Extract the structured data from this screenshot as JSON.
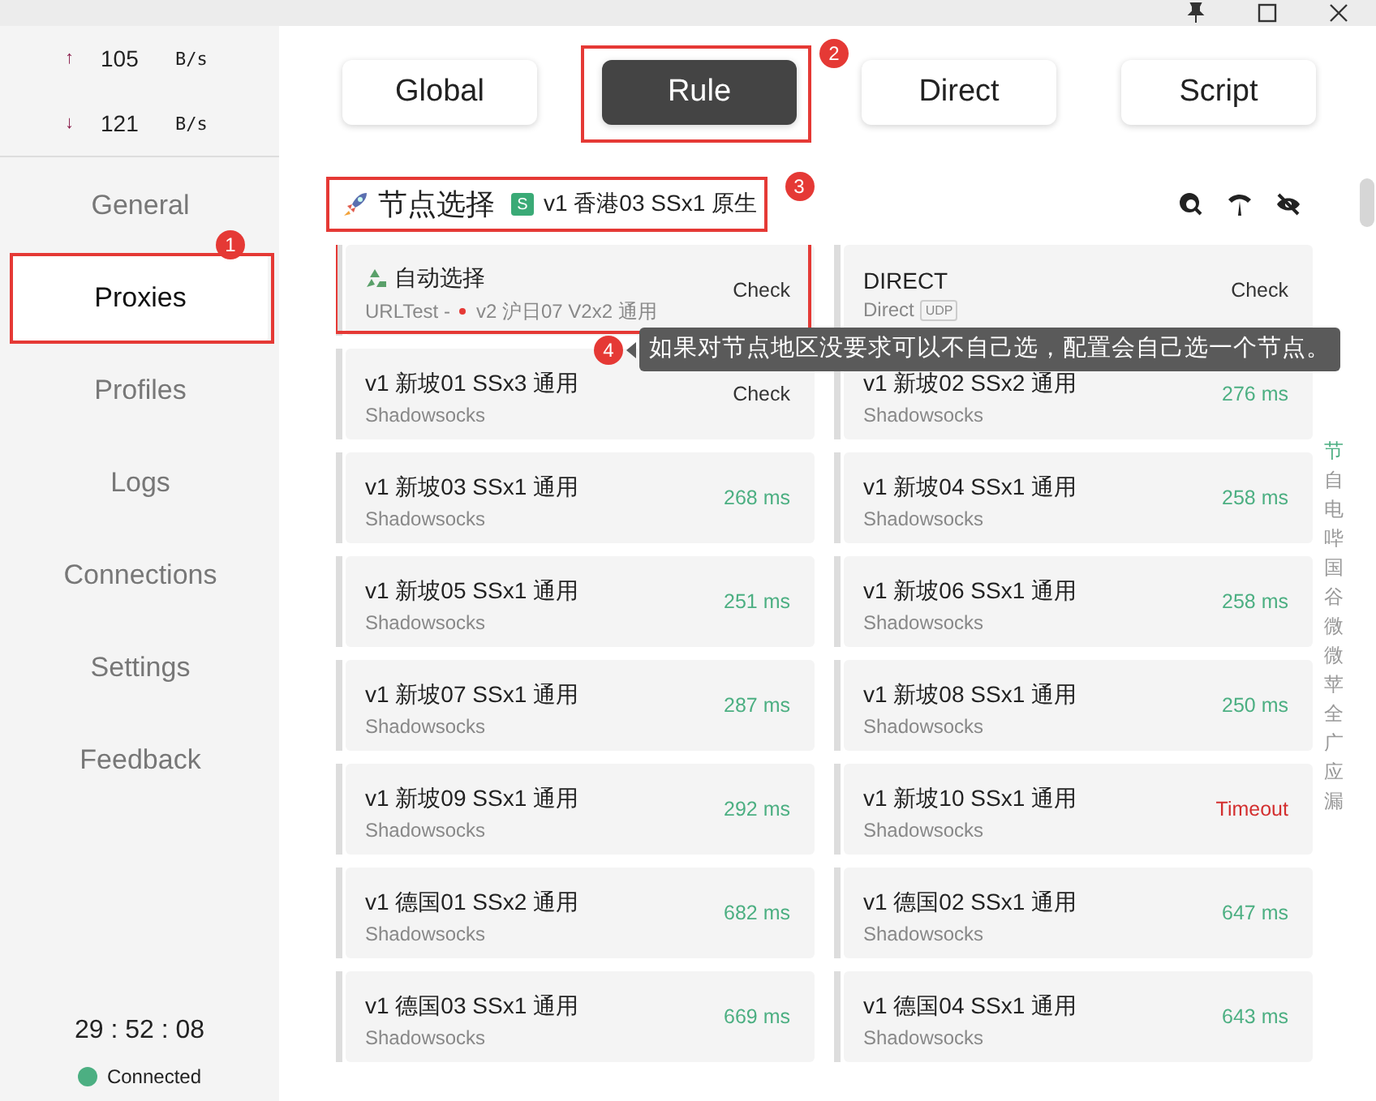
{
  "traffic": [
    {
      "arrow": "↑",
      "value": "105",
      "unit": "B/s"
    },
    {
      "arrow": "↓",
      "value": "121",
      "unit": "B/s"
    }
  ],
  "nav": [
    {
      "label": "General",
      "selected": false
    },
    {
      "label": "Proxies",
      "selected": true,
      "step": "1"
    },
    {
      "label": "Profiles",
      "selected": false
    },
    {
      "label": "Logs",
      "selected": false
    },
    {
      "label": "Connections",
      "selected": false
    },
    {
      "label": "Settings",
      "selected": false
    },
    {
      "label": "Feedback",
      "selected": false
    }
  ],
  "uptime": "29 : 52 : 08",
  "status": {
    "label": "Connected",
    "online": true
  },
  "modes": [
    {
      "label": "Global",
      "selected": false
    },
    {
      "label": "Rule",
      "selected": true,
      "step": "2"
    },
    {
      "label": "Direct",
      "selected": false
    },
    {
      "label": "Script",
      "selected": false
    }
  ],
  "group": {
    "name": "节点选择",
    "badge": "S",
    "current": "v1 香港03 SSx1 原生",
    "step": "3"
  },
  "proxies": [
    {
      "kind": "group",
      "name": "自动选择",
      "type": "URLTest -",
      "now": "v2 沪日07 V2x2 通用",
      "delay": "Check",
      "color": "#333333"
    },
    {
      "kind": "direct",
      "name": "DIRECT",
      "type": "Direct",
      "tag": "UDP",
      "delay": "Check",
      "color": "#333333"
    },
    {
      "kind": "proxy",
      "name": "v1 新坡01 SSx3 通用",
      "type": "Shadowsocks",
      "delay": "Check",
      "color": "#333333"
    },
    {
      "kind": "proxy",
      "name": "v1 新坡02 SSx2 通用",
      "type": "Shadowsocks",
      "delay": "276 ms",
      "color": "#4caf82"
    },
    {
      "kind": "proxy",
      "name": "v1 新坡03 SSx1 通用",
      "type": "Shadowsocks",
      "delay": "268 ms",
      "color": "#4caf82"
    },
    {
      "kind": "proxy",
      "name": "v1 新坡04 SSx1 通用",
      "type": "Shadowsocks",
      "delay": "258 ms",
      "color": "#4caf82"
    },
    {
      "kind": "proxy",
      "name": "v1 新坡05 SSx1 通用",
      "type": "Shadowsocks",
      "delay": "251 ms",
      "color": "#4caf82"
    },
    {
      "kind": "proxy",
      "name": "v1 新坡06 SSx1 通用",
      "type": "Shadowsocks",
      "delay": "258 ms",
      "color": "#4caf82"
    },
    {
      "kind": "proxy",
      "name": "v1 新坡07 SSx1 通用",
      "type": "Shadowsocks",
      "delay": "287 ms",
      "color": "#4caf82"
    },
    {
      "kind": "proxy",
      "name": "v1 新坡08 SSx1 通用",
      "type": "Shadowsocks",
      "delay": "250 ms",
      "color": "#4caf82"
    },
    {
      "kind": "proxy",
      "name": "v1 新坡09 SSx1 通用",
      "type": "Shadowsocks",
      "delay": "292 ms",
      "color": "#4caf82"
    },
    {
      "kind": "proxy",
      "name": "v1 新坡10 SSx1 通用",
      "type": "Shadowsocks",
      "delay": "Timeout",
      "color": "#d32f2f"
    },
    {
      "kind": "proxy",
      "name": "v1 德国01 SSx2 通用",
      "type": "Shadowsocks",
      "delay": "682 ms",
      "color": "#4caf82"
    },
    {
      "kind": "proxy",
      "name": "v1 德国02 SSx1 通用",
      "type": "Shadowsocks",
      "delay": "647 ms",
      "color": "#4caf82"
    },
    {
      "kind": "proxy",
      "name": "v1 德国03 SSx1 通用",
      "type": "Shadowsocks",
      "delay": "669 ms",
      "color": "#4caf82"
    },
    {
      "kind": "proxy",
      "name": "v1 德国04 SSx1 通用",
      "type": "Shadowsocks",
      "delay": "643 ms",
      "color": "#4caf82"
    }
  ],
  "index": [
    {
      "label": "节",
      "selected": true
    },
    {
      "label": "自",
      "selected": false
    },
    {
      "label": "电",
      "selected": false
    },
    {
      "label": "哔",
      "selected": false
    },
    {
      "label": "国",
      "selected": false
    },
    {
      "label": "谷",
      "selected": false
    },
    {
      "label": "微",
      "selected": false
    },
    {
      "label": "微",
      "selected": false
    },
    {
      "label": "苹",
      "selected": false
    },
    {
      "label": "全",
      "selected": false
    },
    {
      "label": "广",
      "selected": false
    },
    {
      "label": "应",
      "selected": false
    },
    {
      "label": "漏",
      "selected": false
    }
  ],
  "tip": {
    "step": "4",
    "text": "如果对节点地区没要求可以不自己选，配置会自己选一个节点。"
  }
}
